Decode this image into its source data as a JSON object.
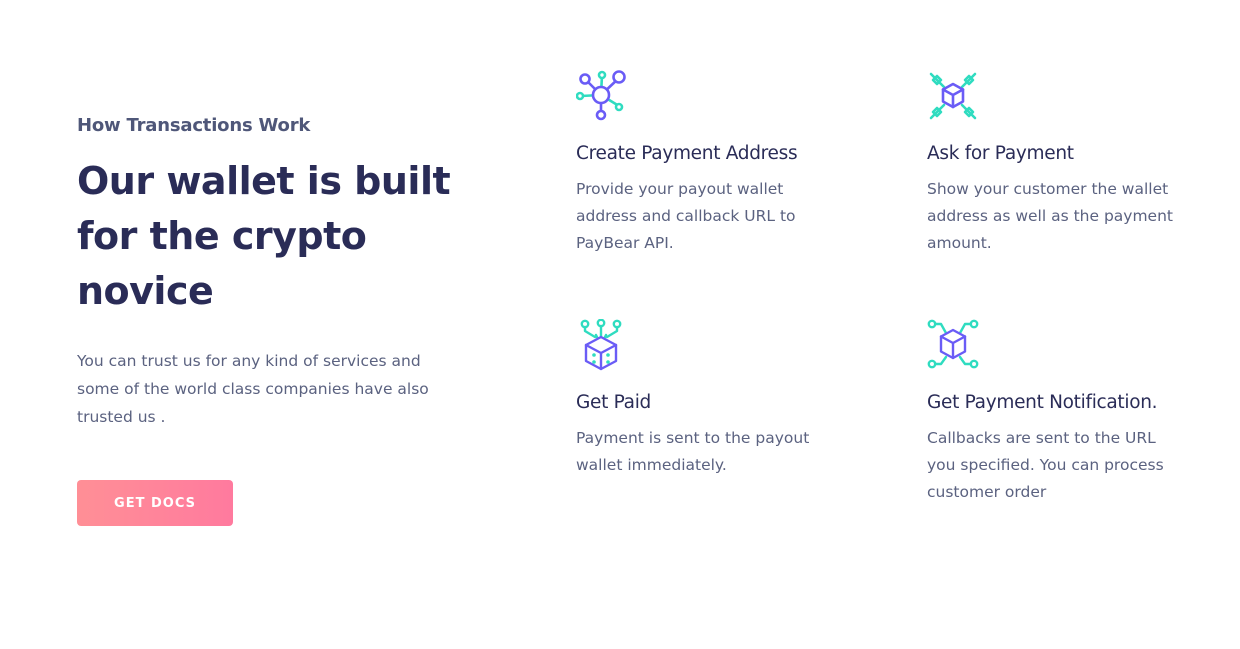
{
  "intro": {
    "eyebrow": "How Transactions Work",
    "headline": "Our wallet is built for the crypto novice",
    "lead": "You can trust us for any kind of services and some of the world class companies have also trusted us .",
    "button_label": "GET DOCS"
  },
  "features": [
    {
      "icon": "network-nodes-icon",
      "title": "Create Payment Address",
      "description": "Provide your payout wallet address and callback URL to PayBear API."
    },
    {
      "icon": "cube-cross-icon",
      "title": "Ask for Payment",
      "description": "Show your customer the wallet address as well as the payment amount."
    },
    {
      "icon": "cube-circuit-icon",
      "title": "Get Paid",
      "description": "Payment is sent to the payout wallet immediately."
    },
    {
      "icon": "cube-notification-icon",
      "title": "Get Payment Notification.",
      "description": "Callbacks are sent to the URL you specified. You can process customer order"
    }
  ],
  "colors": {
    "purple": "#6a5cf6",
    "teal": "#2fdcc0",
    "button_gradient_start": "#ff8f96",
    "button_gradient_end": "#ff7a9e",
    "heading": "#2a2c57",
    "body_text": "#5b6280"
  }
}
